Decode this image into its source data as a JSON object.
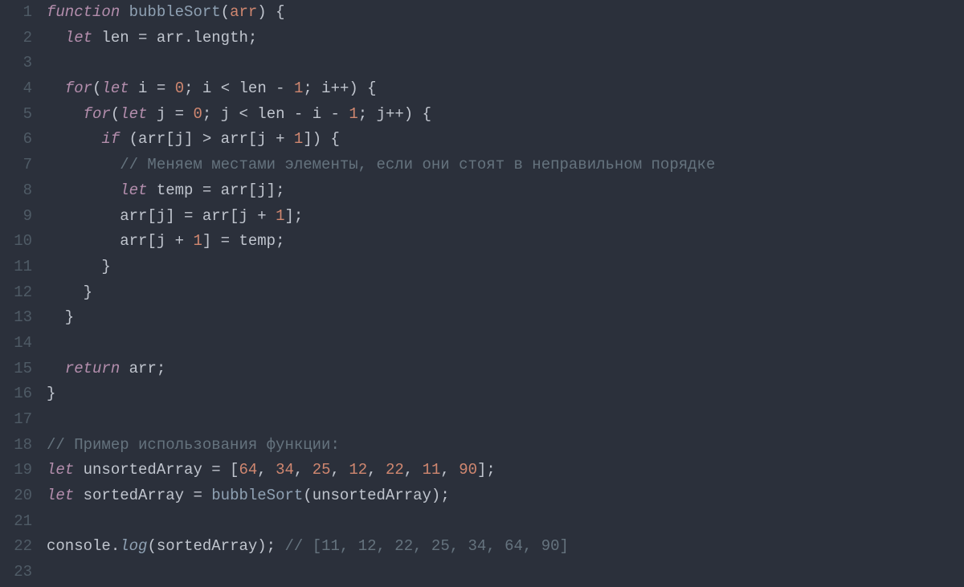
{
  "editor": {
    "lineNumbers": [
      "1",
      "2",
      "3",
      "4",
      "5",
      "6",
      "7",
      "8",
      "9",
      "10",
      "11",
      "12",
      "13",
      "14",
      "15",
      "16",
      "17",
      "18",
      "19",
      "20",
      "21",
      "22",
      "23"
    ],
    "tokens": [
      [
        {
          "t": "function",
          "c": "kw-i"
        },
        {
          "t": " ",
          "c": "id"
        },
        {
          "t": "bubbleSort",
          "c": "fn"
        },
        {
          "t": "(",
          "c": "pun"
        },
        {
          "t": "arr",
          "c": "prm"
        },
        {
          "t": ") {",
          "c": "pun"
        }
      ],
      [
        {
          "t": "  ",
          "c": "id"
        },
        {
          "t": "let",
          "c": "kw-i"
        },
        {
          "t": " len ",
          "c": "id"
        },
        {
          "t": "=",
          "c": "op"
        },
        {
          "t": " arr",
          "c": "id"
        },
        {
          "t": ".",
          "c": "pun"
        },
        {
          "t": "length",
          "c": "id"
        },
        {
          "t": ";",
          "c": "pun"
        }
      ],
      [],
      [
        {
          "t": "  ",
          "c": "id"
        },
        {
          "t": "for",
          "c": "kw-i"
        },
        {
          "t": "(",
          "c": "pun"
        },
        {
          "t": "let",
          "c": "kw-i"
        },
        {
          "t": " i ",
          "c": "id"
        },
        {
          "t": "=",
          "c": "op"
        },
        {
          "t": " ",
          "c": "id"
        },
        {
          "t": "0",
          "c": "num"
        },
        {
          "t": "; i ",
          "c": "id"
        },
        {
          "t": "<",
          "c": "op"
        },
        {
          "t": " len ",
          "c": "id"
        },
        {
          "t": "-",
          "c": "op"
        },
        {
          "t": " ",
          "c": "id"
        },
        {
          "t": "1",
          "c": "num"
        },
        {
          "t": "; i",
          "c": "id"
        },
        {
          "t": "++",
          "c": "op"
        },
        {
          "t": ") {",
          "c": "pun"
        }
      ],
      [
        {
          "t": "    ",
          "c": "id"
        },
        {
          "t": "for",
          "c": "kw-i"
        },
        {
          "t": "(",
          "c": "pun"
        },
        {
          "t": "let",
          "c": "kw-i"
        },
        {
          "t": " j ",
          "c": "id"
        },
        {
          "t": "=",
          "c": "op"
        },
        {
          "t": " ",
          "c": "id"
        },
        {
          "t": "0",
          "c": "num"
        },
        {
          "t": "; j ",
          "c": "id"
        },
        {
          "t": "<",
          "c": "op"
        },
        {
          "t": " len ",
          "c": "id"
        },
        {
          "t": "-",
          "c": "op"
        },
        {
          "t": " i ",
          "c": "id"
        },
        {
          "t": "-",
          "c": "op"
        },
        {
          "t": " ",
          "c": "id"
        },
        {
          "t": "1",
          "c": "num"
        },
        {
          "t": "; j",
          "c": "id"
        },
        {
          "t": "++",
          "c": "op"
        },
        {
          "t": ") {",
          "c": "pun"
        }
      ],
      [
        {
          "t": "      ",
          "c": "id"
        },
        {
          "t": "if",
          "c": "kw-i"
        },
        {
          "t": " (arr[j] ",
          "c": "id"
        },
        {
          "t": ">",
          "c": "op"
        },
        {
          "t": " arr[j ",
          "c": "id"
        },
        {
          "t": "+",
          "c": "op"
        },
        {
          "t": " ",
          "c": "id"
        },
        {
          "t": "1",
          "c": "num"
        },
        {
          "t": "]) {",
          "c": "pun"
        }
      ],
      [
        {
          "t": "        ",
          "c": "id"
        },
        {
          "t": "// Меняем местами элементы, если они стоят в неправильном порядке",
          "c": "cmt"
        }
      ],
      [
        {
          "t": "        ",
          "c": "id"
        },
        {
          "t": "let",
          "c": "kw-i"
        },
        {
          "t": " temp ",
          "c": "id"
        },
        {
          "t": "=",
          "c": "op"
        },
        {
          "t": " arr[j];",
          "c": "id"
        }
      ],
      [
        {
          "t": "        arr[j] ",
          "c": "id"
        },
        {
          "t": "=",
          "c": "op"
        },
        {
          "t": " arr[j ",
          "c": "id"
        },
        {
          "t": "+",
          "c": "op"
        },
        {
          "t": " ",
          "c": "id"
        },
        {
          "t": "1",
          "c": "num"
        },
        {
          "t": "];",
          "c": "id"
        }
      ],
      [
        {
          "t": "        arr[j ",
          "c": "id"
        },
        {
          "t": "+",
          "c": "op"
        },
        {
          "t": " ",
          "c": "id"
        },
        {
          "t": "1",
          "c": "num"
        },
        {
          "t": "] ",
          "c": "id"
        },
        {
          "t": "=",
          "c": "op"
        },
        {
          "t": " temp;",
          "c": "id"
        }
      ],
      [
        {
          "t": "      }",
          "c": "pun"
        }
      ],
      [
        {
          "t": "    }",
          "c": "pun"
        }
      ],
      [
        {
          "t": "  }",
          "c": "pun"
        }
      ],
      [],
      [
        {
          "t": "  ",
          "c": "id"
        },
        {
          "t": "return",
          "c": "kw-i"
        },
        {
          "t": " arr;",
          "c": "id"
        }
      ],
      [
        {
          "t": "}",
          "c": "pun"
        }
      ],
      [],
      [
        {
          "t": "// Пример использования функции:",
          "c": "cmt"
        }
      ],
      [
        {
          "t": "let",
          "c": "kw-i"
        },
        {
          "t": " unsortedArray ",
          "c": "id"
        },
        {
          "t": "=",
          "c": "op"
        },
        {
          "t": " [",
          "c": "pun"
        },
        {
          "t": "64",
          "c": "num"
        },
        {
          "t": ", ",
          "c": "pun"
        },
        {
          "t": "34",
          "c": "num"
        },
        {
          "t": ", ",
          "c": "pun"
        },
        {
          "t": "25",
          "c": "num"
        },
        {
          "t": ", ",
          "c": "pun"
        },
        {
          "t": "12",
          "c": "num"
        },
        {
          "t": ", ",
          "c": "pun"
        },
        {
          "t": "22",
          "c": "num"
        },
        {
          "t": ", ",
          "c": "pun"
        },
        {
          "t": "11",
          "c": "num"
        },
        {
          "t": ", ",
          "c": "pun"
        },
        {
          "t": "90",
          "c": "num"
        },
        {
          "t": "];",
          "c": "pun"
        }
      ],
      [
        {
          "t": "let",
          "c": "kw-i"
        },
        {
          "t": " sortedArray ",
          "c": "id"
        },
        {
          "t": "=",
          "c": "op"
        },
        {
          "t": " ",
          "c": "id"
        },
        {
          "t": "bubbleSort",
          "c": "fn"
        },
        {
          "t": "(unsortedArray);",
          "c": "id"
        }
      ],
      [],
      [
        {
          "t": "console",
          "c": "id"
        },
        {
          "t": ".",
          "c": "pun"
        },
        {
          "t": "log",
          "c": "fn-i"
        },
        {
          "t": "(sortedArray); ",
          "c": "id"
        },
        {
          "t": "// [11, 12, 22, 25, 34, 64, 90]",
          "c": "cmt"
        }
      ],
      []
    ]
  }
}
